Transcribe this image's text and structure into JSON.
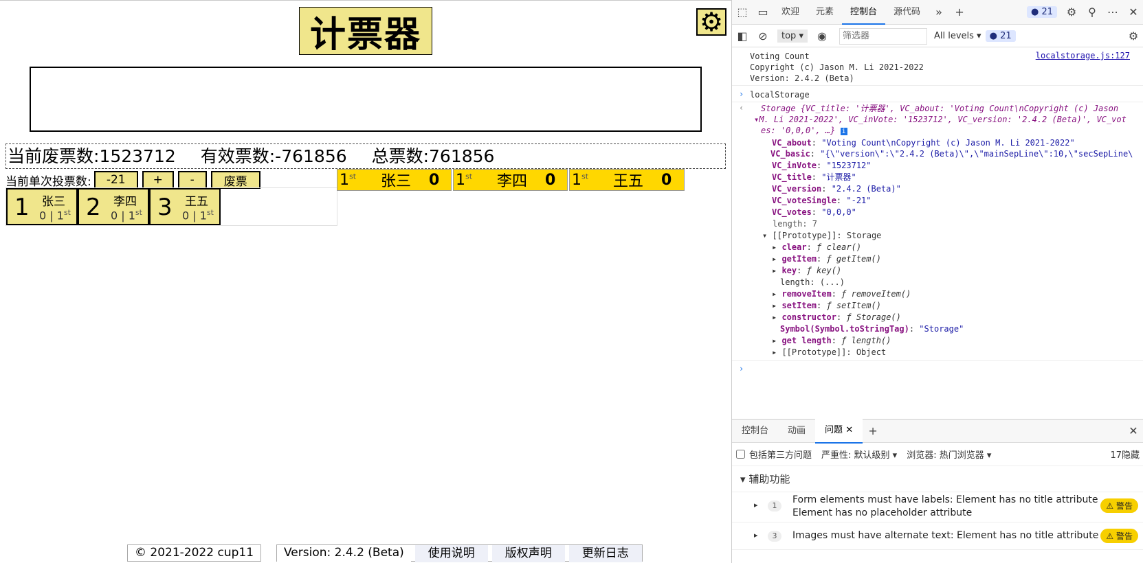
{
  "app": {
    "title": "计票器",
    "settings_icon": "gear-icon",
    "stats": {
      "invalid_label": "当前废票数:",
      "invalid_value": "1523712",
      "valid_label": "有效票数:",
      "valid_value": "-761856",
      "total_label": "总票数:",
      "total_value": "761856"
    },
    "controls": {
      "single_vote_label": "当前单次投票数:",
      "single_vote_value": "-21",
      "plus": "+",
      "minus": "-",
      "invalid_button": "废票"
    },
    "candidates": [
      {
        "num": "1",
        "name": "张三",
        "score": "0 | 1",
        "rank_suffix": "st"
      },
      {
        "num": "2",
        "name": "李四",
        "score": "0 | 1",
        "rank_suffix": "st"
      },
      {
        "num": "3",
        "name": "王五",
        "score": "0 | 1",
        "rank_suffix": "st"
      }
    ],
    "ranking": [
      {
        "rank": "1",
        "suffix": "st",
        "name": "张三",
        "votes": "0"
      },
      {
        "rank": "1",
        "suffix": "st",
        "name": "李四",
        "votes": "0"
      },
      {
        "rank": "1",
        "suffix": "st",
        "name": "王五",
        "votes": "0"
      }
    ],
    "footer": {
      "copyright": "© 2021-2022 cup11",
      "version": "Version: 2.4.2 (Beta)",
      "links": [
        "使用说明",
        "版权声明",
        "更新日志"
      ]
    }
  },
  "devtools": {
    "tabs": [
      "欢迎",
      "元素",
      "控制台",
      "源代码"
    ],
    "active_tab": "控制台",
    "badge_count": "21",
    "toolbar": {
      "context": "top",
      "filter_placeholder": "筛选器",
      "levels": "All levels",
      "badge_count": "21"
    },
    "console": {
      "log_lines": [
        "Voting Count",
        "Copyright (c) Jason M. Li 2021-2022",
        "Version: 2.4.2 (Beta)"
      ],
      "source_link": "localstorage.js:127",
      "command": "localStorage",
      "storage_summary_1": "Storage {VC_title: '计票器', VC_about: 'Voting Count\\nCopyright (c) Jason",
      "storage_summary_2": "M. Li 2021-2022', VC_inVote: '1523712', VC_version: '2.4.2 (Beta)', VC_vot",
      "storage_summary_3": "es: '0,0,0', …}",
      "entries": [
        {
          "key": "VC_about",
          "value": "\"Voting Count\\nCopyright (c) Jason M. Li 2021-2022\""
        },
        {
          "key": "VC_basic",
          "value": "\"{\\\"version\\\":\\\"2.4.2 (Beta)\\\",\\\"mainSepLine\\\":10,\\\"secSepLine\\"
        },
        {
          "key": "VC_inVote",
          "value": "\"1523712\""
        },
        {
          "key": "VC_title",
          "value": "\"计票器\""
        },
        {
          "key": "VC_version",
          "value": "\"2.4.2 (Beta)\""
        },
        {
          "key": "VC_voteSingle",
          "value": "\"-21\""
        },
        {
          "key": "VC_votes",
          "value": "\"0,0,0\""
        }
      ],
      "length_line": "length: 7",
      "prototype_line": "[[Prototype]]: Storage",
      "proto_items": [
        {
          "key": "clear",
          "value": "ƒ clear()"
        },
        {
          "key": "getItem",
          "value": "ƒ getItem()"
        },
        {
          "key": "key",
          "value": "ƒ key()"
        },
        {
          "key": "length",
          "value": "(...)"
        },
        {
          "key": "removeItem",
          "value": "ƒ removeItem()"
        },
        {
          "key": "setItem",
          "value": "ƒ setItem()"
        },
        {
          "key": "constructor",
          "value": "ƒ Storage()"
        },
        {
          "key": "Symbol(Symbol.toStringTag)",
          "value": "\"Storage\""
        },
        {
          "key": "get length",
          "value": "ƒ length()"
        },
        {
          "key": "[[Prototype]]",
          "value": "Object"
        }
      ]
    },
    "drawer": {
      "tabs": [
        "控制台",
        "动画",
        "问题"
      ],
      "active_tab": "问题",
      "third_party": "包括第三方问题",
      "severity": "严重性: 默认级别 ▾",
      "browser": "浏览器: 热门浏览器 ▾",
      "hidden": "17隐藏",
      "section": "辅助功能",
      "issues": [
        {
          "count": "1",
          "line1": "Form elements must have labels: Element has no title attribute",
          "line2": "Element has no placeholder attribute",
          "level": "⚠ 警告"
        },
        {
          "count": "3",
          "line1": "Images must have alternate text: Element has no title attribute",
          "line2": "",
          "level": "⚠ 警告"
        }
      ]
    }
  }
}
